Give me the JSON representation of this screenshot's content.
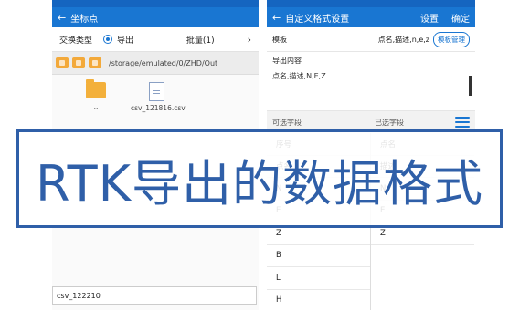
{
  "left": {
    "title": "坐标点",
    "export_type_label": "交换类型",
    "export_option": "导出",
    "batch_label": "批量(1)",
    "path": "/storage/emulated/0/ZHD/Out",
    "files": [
      {
        "name": "..",
        "type": "folder"
      },
      {
        "name": "csv_121816.csv",
        "type": "file"
      }
    ],
    "filename_value": "csv_122210"
  },
  "right": {
    "title": "自定义格式设置",
    "settings_label": "设置",
    "confirm_label": "确定",
    "template_label": "模板",
    "template_value": "点名,描述,n,e,z",
    "template_manage_button": "模板管理",
    "export_content_label": "导出内容",
    "export_content_value": "点名,描述,N,E,Z",
    "available_fields_label": "可选字段",
    "selected_fields_label": "已选字段",
    "available_fields": [
      "序号",
      "点名",
      "N",
      "E",
      "Z",
      "B",
      "L",
      "H"
    ],
    "selected_fields": [
      "点名",
      "描述",
      "N",
      "E",
      "Z"
    ]
  },
  "banner": {
    "text": "RTK导出的数据格式"
  },
  "colors": {
    "appbar": "#1976d2",
    "accent": "#2f5fa8",
    "folder": "#f3b03b"
  }
}
